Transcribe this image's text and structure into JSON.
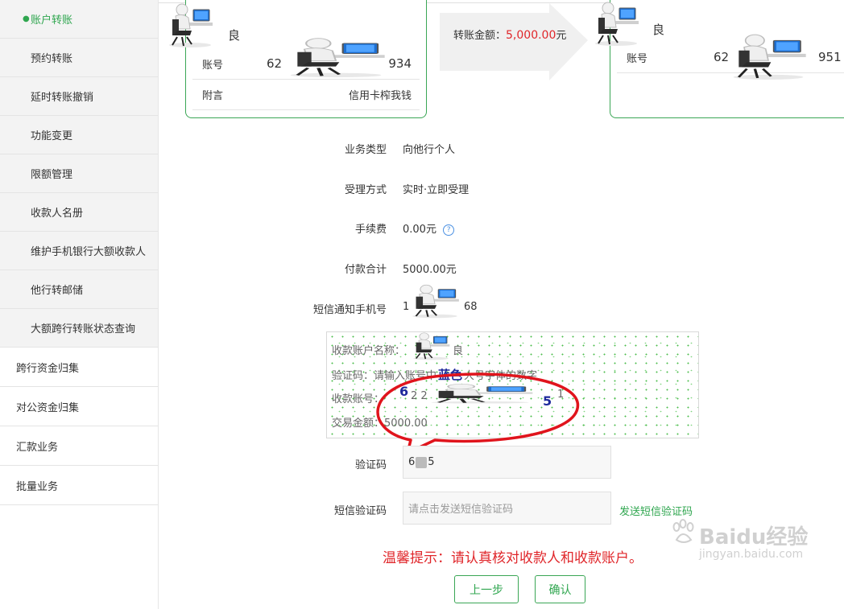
{
  "sidebar": {
    "active": "账户转账",
    "sub_items": [
      "预约转账",
      "延时转账撤销",
      "功能变更",
      "限额管理",
      "收款人名册",
      "维护手机银行大额收款人",
      "他行转邮储",
      "大额跨行转账状态查询"
    ],
    "top_items": [
      "跨行资金归集",
      "对公资金归集",
      "汇款业务",
      "批量业务"
    ]
  },
  "payer_card": {
    "name_suffix": "良",
    "account_label": "账号",
    "account_prefix": "62",
    "account_suffix": "934",
    "memo_label": "附言",
    "memo_value": "信用卡榨我钱"
  },
  "transfer": {
    "amount_label": "转账金额：",
    "amount_value": "5,000.00",
    "amount_unit": "元"
  },
  "payee_card": {
    "name_suffix": "良",
    "account_label": "账号",
    "account_prefix": "62",
    "account_suffix": "951"
  },
  "details": {
    "business_type_label": "业务类型",
    "business_type_value": "向他行个人",
    "method_label": "受理方式",
    "method_value": "实时·立即受理",
    "fee_label": "手续费",
    "fee_value": "0.00元",
    "total_label": "付款合计",
    "total_value": "5000.00元",
    "sms_phone_label": "短信通知手机号",
    "sms_phone_prefix": "1",
    "sms_phone_suffix": "68"
  },
  "info_box": {
    "payee_name_label": "收款账户名称：",
    "payee_name_suffix": "良",
    "hint_prefix": "验证码：请输入账号中",
    "hint_highlight": "蓝色",
    "hint_suffix": "大号字体的数字",
    "account_label": "收款账号：",
    "digit_big1": "6",
    "digits_small1": "2 2",
    "digit_big2": "5",
    "digits_small2": "1",
    "amount_label": "交易金额：",
    "amount_value": "5000.00"
  },
  "captcha": {
    "label": "验证码",
    "prefix": "6",
    "suffix": "5"
  },
  "sms_code": {
    "label": "短信验证码",
    "placeholder": "请点击发送短信验证码",
    "send_link": "发送短信验证码"
  },
  "tip": "温馨提示：请认真核对收款人和收款账户。",
  "buttons": {
    "prev": "上一步",
    "confirm": "确认"
  },
  "watermark": {
    "brand": "Baidu经验",
    "url": "jingyan.baidu.com"
  },
  "colors": {
    "accent": "#2fa64f",
    "amount_red": "#e0262a",
    "highlight_blue": "#1f2a9c",
    "annotation_red": "#e0141c"
  }
}
